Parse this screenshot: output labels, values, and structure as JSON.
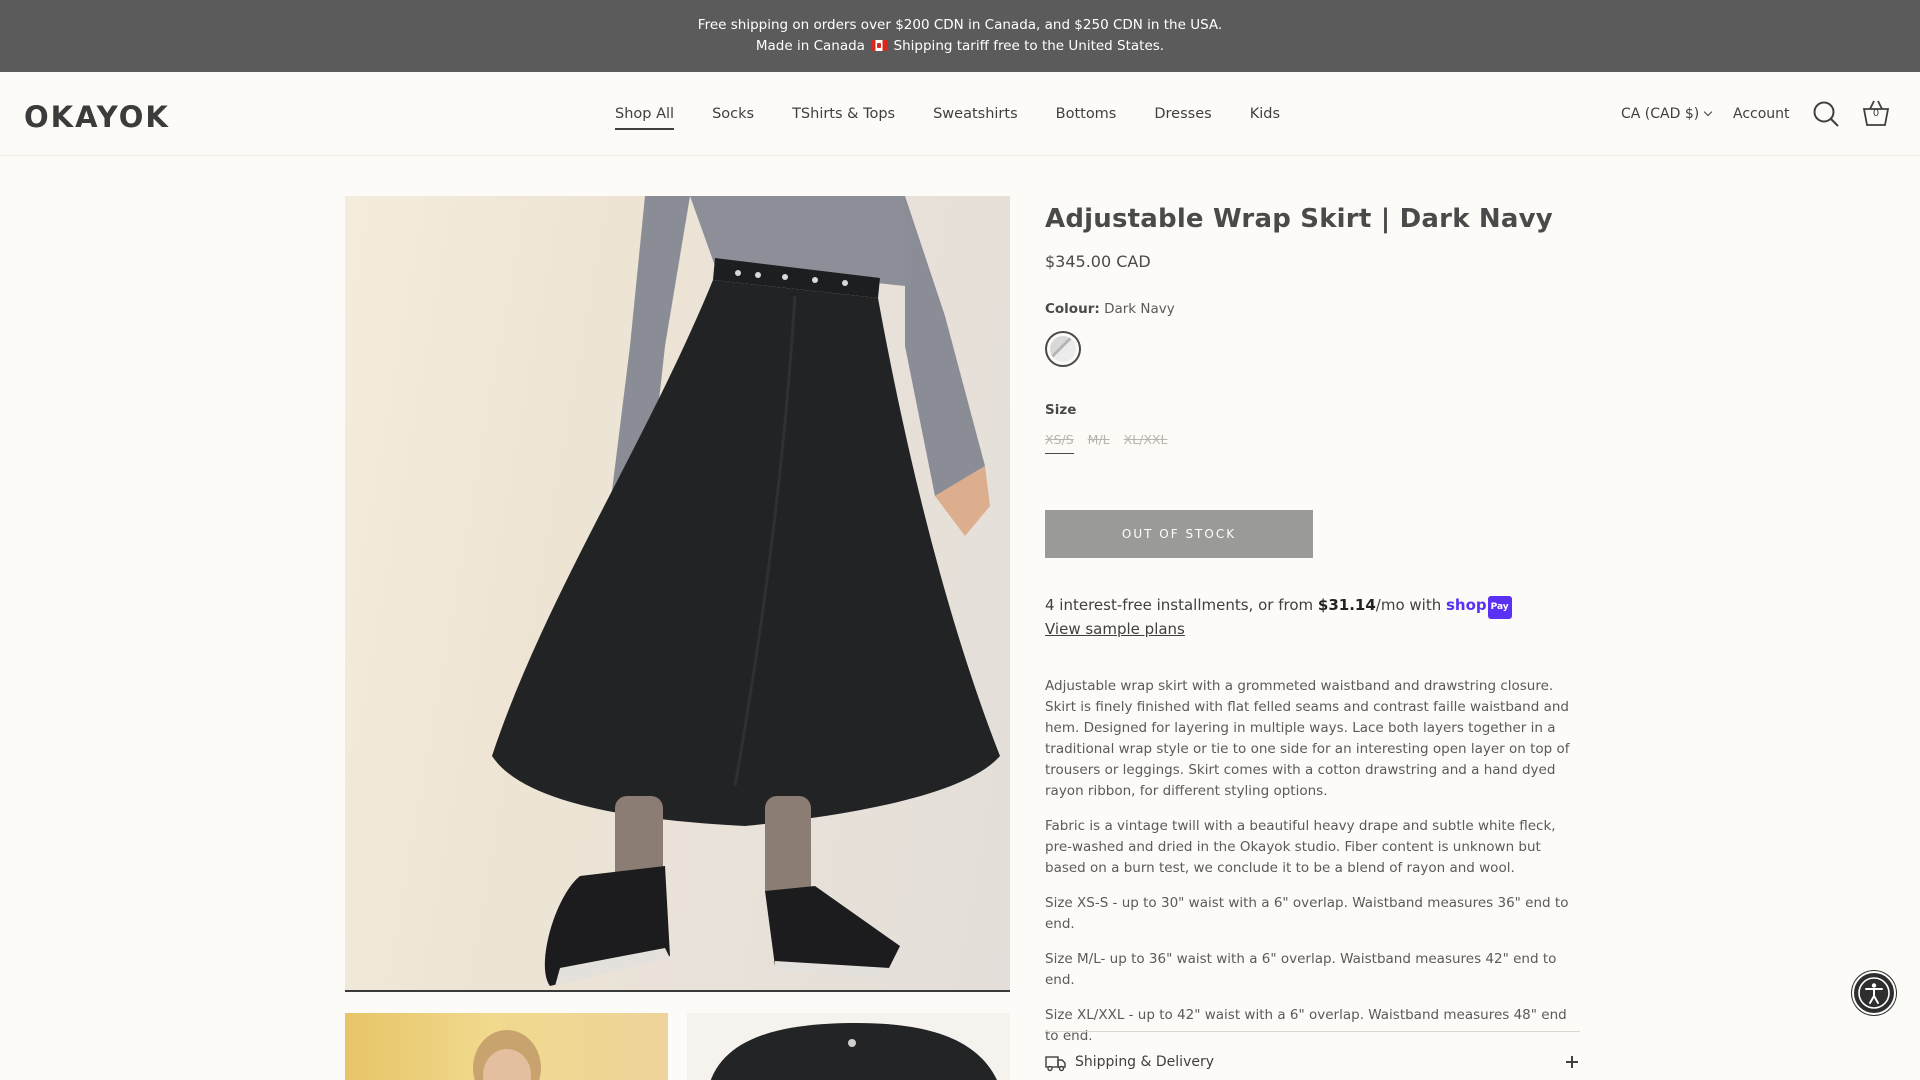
{
  "announcement": {
    "line1": "Free shipping on orders over $200 CDN in Canada, and $250 CDN in the USA.",
    "line2_pre": "Made in Canada",
    "line2_post": "Shipping tariff free to the United States."
  },
  "header": {
    "logo": "OKAYOK",
    "nav": [
      "Shop All",
      "Socks",
      "TShirts & Tops",
      "Sweatshirts",
      "Bottoms",
      "Dresses",
      "Kids"
    ],
    "active_nav": "Shop All",
    "currency": "CA (CAD $)",
    "account": "Account",
    "cart_count": "0",
    "icons": [
      "search-icon",
      "basket-icon",
      "chevron-down-icon"
    ]
  },
  "product": {
    "title": "Adjustable Wrap Skirt | Dark Navy",
    "price": "$345.00 CAD",
    "colour_label": "Colour:",
    "colour_value": "Dark Navy",
    "size_label": "Size",
    "sizes": [
      "XS/S",
      "M/L",
      "XL/XXL"
    ],
    "button": "OUT OF STOCK"
  },
  "shoppay": {
    "pre": "4 interest-free installments, or from ",
    "amount": "$31.14",
    "post": "/mo with ",
    "brand_shop": "shop",
    "brand_pay": "Pay",
    "link": "View sample plans"
  },
  "description": [
    "Adjustable wrap skirt with a grommeted waistband and drawstring closure. Skirt is finely finished with flat felled seams and contrast faille waistband and hem. Designed for layering in multiple ways. Lace both layers together in a traditional wrap style or tie to one side for an interesting open layer on top of trousers or leggings. Skirt comes with a cotton drawstring and a hand dyed rayon ribbon, for different styling options.",
    "Fabric is a vintage twill with a beautiful heavy drape and subtle white fleck, pre-washed and dried in the Okayok studio. Fiber content is unknown but based on a burn test, we conclude it to be a blend of rayon and wool.",
    "Size XS-S - up to 30\" waist with a 6\" overlap. Waistband measures 36\" end to end.",
    "Size M/L- up to 36\" waist with a 6\" overlap. Waistband measures 42\" end to end.",
    "Size XL/XXL - up to 42\" waist with a 6\" overlap. Waistband measures 48\" end to end."
  ],
  "accordion": {
    "shipping": "Shipping & Delivery"
  },
  "colors": {
    "announcement_bg": "#5b5b5b",
    "page_bg": "#fdfbf7",
    "button_bg": "#9a9a97",
    "shoppay_brand": "#5a31f4",
    "text": "#4a4a4a"
  }
}
